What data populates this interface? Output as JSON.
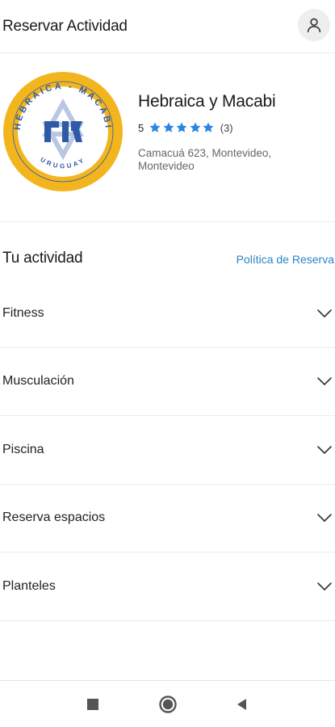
{
  "header": {
    "title": "Reservar Actividad",
    "icons": {
      "profile": "user-icon"
    }
  },
  "venue": {
    "logo_icon": "hebraica-macabi-logo",
    "logo_text_top": "HEBRAICA - MACABI",
    "logo_text_bottom": "URUGUAY",
    "name": "Hebraica y Macabi",
    "rating": "5",
    "stars": 5,
    "review_count": "(3)",
    "address": "Camacuá 623, Montevideo, Montevideo"
  },
  "activity": {
    "title": "Tu actividad",
    "policy_link": "Política de Reserva",
    "categories": [
      {
        "label": "Fitness"
      },
      {
        "label": "Musculación"
      },
      {
        "label": "Piscina"
      },
      {
        "label": "Reserva espacios"
      },
      {
        "label": "Planteles"
      }
    ]
  },
  "navbar": {
    "icons": [
      "square-icon",
      "circle-icon",
      "back-triangle-icon"
    ]
  },
  "colors": {
    "star": "#2a86e0",
    "link": "#2a86c7",
    "logo_ring": "#f3b51e",
    "logo_blue": "#2f5aa5"
  }
}
